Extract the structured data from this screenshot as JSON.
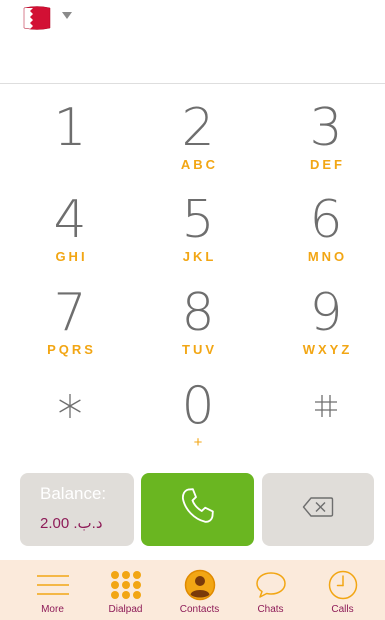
{
  "header": {
    "country_flag_icon": "bahrain-flag-icon",
    "dropdown_icon": "caret-down-icon"
  },
  "keypad": {
    "keys": [
      {
        "digit": "1",
        "letters": ""
      },
      {
        "digit": "2",
        "letters": "ABC"
      },
      {
        "digit": "3",
        "letters": "DEF"
      },
      {
        "digit": "4",
        "letters": "GHI"
      },
      {
        "digit": "5",
        "letters": "JKL"
      },
      {
        "digit": "6",
        "letters": "MNO"
      },
      {
        "digit": "7",
        "letters": "PQRS"
      },
      {
        "digit": "8",
        "letters": "TUV"
      },
      {
        "digit": "9",
        "letters": "WXYZ"
      },
      {
        "digit": "*",
        "letters": ""
      },
      {
        "digit": "0",
        "letters": "+"
      },
      {
        "digit": "#",
        "letters": ""
      }
    ]
  },
  "actions": {
    "balance_label": "Balance:",
    "balance_value": "د.ب. 2.00",
    "call_icon": "phone-icon",
    "delete_icon": "backspace-icon"
  },
  "tabs": {
    "more": "More",
    "dialpad": "Dialpad",
    "contacts": "Contacts",
    "chats": "Chats",
    "calls": "Calls"
  },
  "colors": {
    "accent_orange": "#f2a614",
    "brand_purple": "#8e1c58",
    "call_green": "#6ab621",
    "button_gray": "#e0ddd9",
    "tab_bar_bg": "#fbeadb"
  }
}
